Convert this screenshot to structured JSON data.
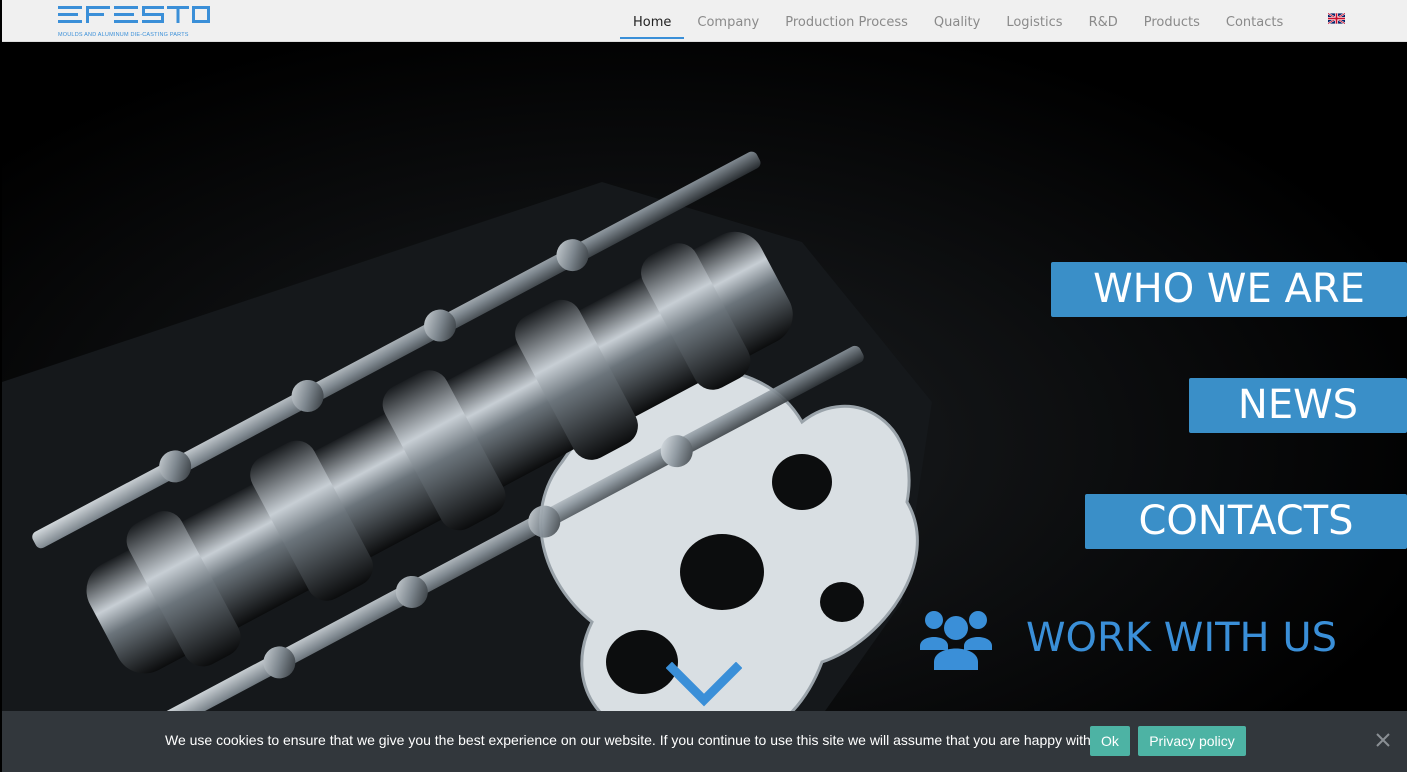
{
  "brand": {
    "name": "EFESTO",
    "tagline": "MOULDS AND ALUMINUM DIE-CASTING PARTS",
    "color": "#3a8fd8"
  },
  "nav": {
    "items": [
      {
        "label": "Home",
        "active": true
      },
      {
        "label": "Company",
        "active": false
      },
      {
        "label": "Production Process",
        "active": false
      },
      {
        "label": "Quality",
        "active": false
      },
      {
        "label": "Logistics",
        "active": false
      },
      {
        "label": "R&D",
        "active": false
      },
      {
        "label": "Products",
        "active": false
      },
      {
        "label": "Contacts",
        "active": false
      }
    ],
    "language_icon": "uk-flag-icon"
  },
  "hero": {
    "image_icon": "engine-camshaft-photo",
    "buttons": {
      "who_we_are": "WHO WE ARE",
      "news": "NEWS",
      "contacts": "CONTACTS"
    },
    "work_with_us": {
      "label": "WORK WITH US",
      "icon": "users-group-icon"
    },
    "scroll_icon": "chevron-down-icon",
    "accent_color": "#3a8fc8"
  },
  "cookie_notice": {
    "text": "We use cookies to ensure that we give you the best experience on our website. If you continue to use this site we will assume that you are happy with it.",
    "ok_label": "Ok",
    "privacy_label": "Privacy policy",
    "close_icon": "close-icon",
    "button_color": "#4db3a4",
    "background": "#32373c"
  }
}
